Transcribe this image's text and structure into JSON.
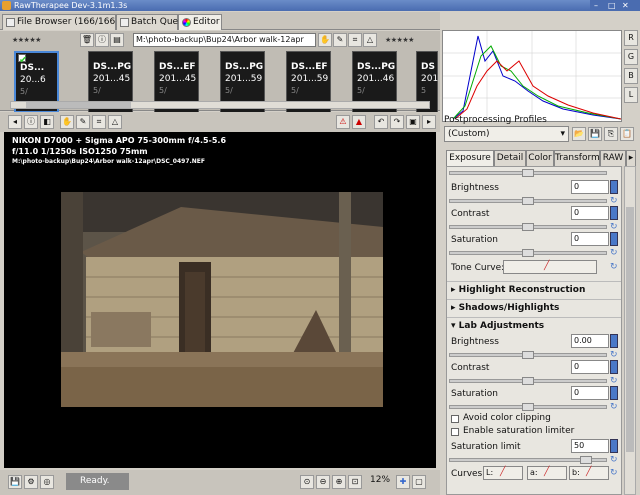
{
  "window": {
    "title": "RawTherapee Dev-3.1m1.3s"
  },
  "tabs": [
    {
      "label": "File Browser",
      "count": "(166/166)"
    },
    {
      "label": "Batch Queue"
    },
    {
      "label": "Editor"
    }
  ],
  "filmstrip": {
    "stars": "★★★★★",
    "path": "M:\\photo-backup\\Bup24\\Arbor walk-12apr",
    "thumbs": [
      {
        "name": "DS...",
        "date": "20...6",
        "extra": "5/"
      },
      {
        "name": "DS...PG",
        "date": "201...45",
        "extra": "5/"
      },
      {
        "name": "DS...EF",
        "date": "201...45",
        "extra": "5/"
      },
      {
        "name": "DS...PG",
        "date": "201...59",
        "extra": "5/"
      },
      {
        "name": "DS...EF",
        "date": "201...59",
        "extra": "5/"
      },
      {
        "name": "DS...PG",
        "date": "201...46",
        "extra": "5/"
      },
      {
        "name": "DS",
        "date": "201",
        "extra": "5"
      }
    ]
  },
  "viewer": {
    "line1": "NIKON D7000 + Sigma APO 75-300mm f/4.5-5.6",
    "line2": "f/11.0  1/1250s  ISO1250  75mm",
    "line3": "M:\\photo-backup\\Bup24\\Arbor walk-12apr\\DSC_0497.NEF"
  },
  "status": {
    "text": "Ready.",
    "zoom": "12%"
  },
  "right": {
    "profiles_label": "Postprocessing Profiles",
    "profile_value": "(Custom)",
    "histo_buttons": [
      "R",
      "G",
      "B",
      "L"
    ],
    "tabs": [
      "Exposure",
      "Detail",
      "Color",
      "Transform",
      "RAW"
    ],
    "exposure": {
      "brightness_label": "Brightness",
      "brightness_value": "0",
      "contrast_label": "Contrast",
      "contrast_value": "0",
      "saturation_label": "Saturation",
      "saturation_value": "0",
      "tone_curve_label": "Tone Curve:"
    },
    "sections": {
      "highlight": "Highlight Reconstruction",
      "shadows": "Shadows/Highlights",
      "lab": "Lab Adjustments"
    },
    "lab": {
      "brightness_label": "Brightness",
      "brightness_value": "0.00",
      "contrast_label": "Contrast",
      "contrast_value": "0",
      "saturation_label": "Saturation",
      "saturation_value": "0",
      "avoid_clip": "Avoid color clipping",
      "enable_sat": "Enable saturation limiter",
      "sat_limit_label": "Saturation limit",
      "sat_limit_value": "50",
      "curves_label": "Curves:",
      "curve_l": "L:",
      "curve_a": "a:",
      "curve_b": "b:"
    }
  }
}
